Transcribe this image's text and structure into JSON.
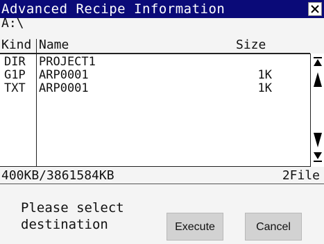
{
  "window": {
    "title": "Advanced Recipe Information"
  },
  "path": "A:\\",
  "columns": {
    "kind": "Kind",
    "name": "Name",
    "size": "Size"
  },
  "rows": [
    {
      "kind": "DIR",
      "name": "PROJECT1",
      "size": ""
    },
    {
      "kind": "G1P",
      "name": "ARP0001",
      "size": "1K"
    },
    {
      "kind": "TXT",
      "name": "ARP0001",
      "size": "1K"
    }
  ],
  "status": {
    "capacity": "400KB/3861584KB",
    "file_count": "2File"
  },
  "message": "Please select\ndestination",
  "buttons": {
    "execute": "Execute",
    "cancel": "Cancel"
  },
  "icons": {
    "close": "close-icon",
    "scroll_top": "scroll-to-top-icon",
    "scroll_up": "scroll-up-icon",
    "scroll_down": "scroll-down-icon",
    "scroll_bottom": "scroll-to-bottom-icon"
  },
  "colors": {
    "titlebar": "#0a0a78",
    "button": "#d2d2d2",
    "list_bg": "#ffffff",
    "panel_bg": "#f4f4f4"
  }
}
